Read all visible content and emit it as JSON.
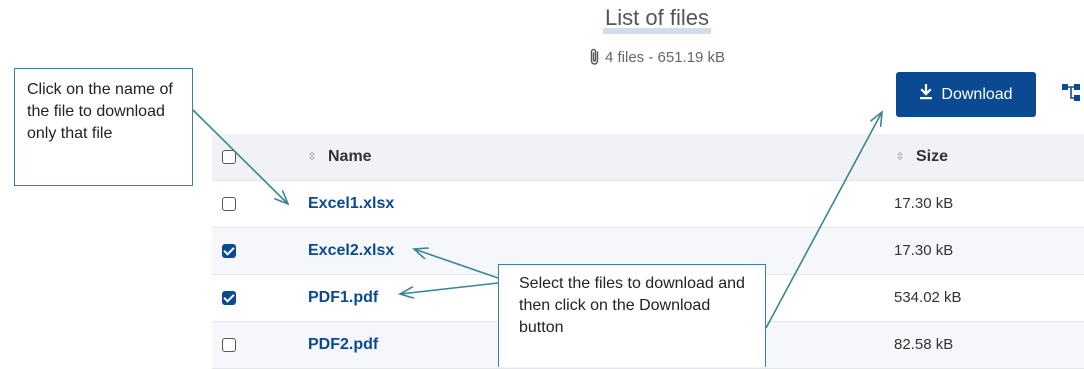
{
  "header": {
    "title": "List of files",
    "summary": "4 files - 651.19 kB"
  },
  "toolbar": {
    "download_label": "Download"
  },
  "table": {
    "columns": [
      "Name",
      "Size"
    ],
    "rows": [
      {
        "name": "Excel1.xlsx",
        "size": "17.30 kB",
        "checked": false
      },
      {
        "name": "Excel2.xlsx",
        "size": "17.30 kB",
        "checked": true
      },
      {
        "name": "PDF1.pdf",
        "size": "534.02 kB",
        "checked": true
      },
      {
        "name": "PDF2.pdf",
        "size": "82.58 kB",
        "checked": false
      }
    ]
  },
  "callouts": {
    "single_file": "Click on the name of the file to download only that file",
    "multi_select": "Select the files to download and then click on the Download button"
  },
  "colors": {
    "primary": "#0b4a92",
    "callout_border": "#3b8496",
    "header_row_bg": "#f0f2f5"
  },
  "icons": {
    "attachment": "paperclip-icon",
    "download": "download-icon",
    "tree": "hierarchy-icon",
    "sort": "sort-icon"
  }
}
